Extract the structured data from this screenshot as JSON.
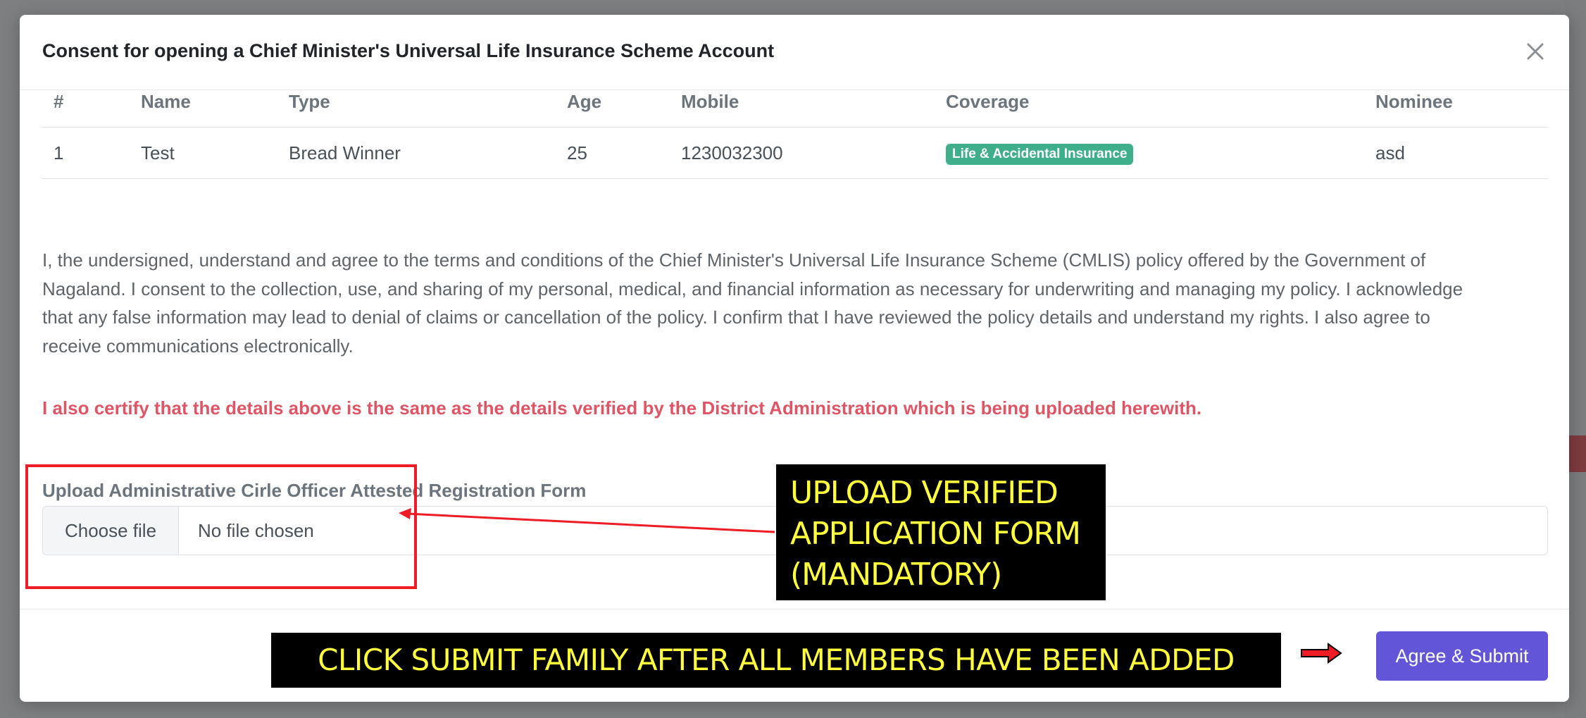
{
  "modal": {
    "title": "Consent for opening a Chief Minister's Universal Life Insurance Scheme Account",
    "close_icon": "close-icon"
  },
  "table": {
    "headers": [
      "#",
      "Name",
      "Type",
      "Age",
      "Mobile",
      "Coverage",
      "Nominee"
    ],
    "rows": [
      {
        "num": "1",
        "name": "Test",
        "type": "Bread Winner",
        "age": "25",
        "mobile": "1230032300",
        "coverage": "Life & Accidental Insurance",
        "nominee": "asd"
      }
    ]
  },
  "consent": {
    "lines": [
      "I, the undersigned, understand and agree to the terms and conditions of the Chief Minister's Universal Life Insurance Scheme (CMLIS) policy offered by the Government of",
      "Nagaland. I consent to the collection, use, and sharing of my personal, medical, and financial information as necessary for underwriting and managing my policy. I acknowledge",
      "that any false information may lead to denial of claims or cancellation of the policy. I confirm that I have reviewed the policy details and understand my rights. I also agree to",
      "receive communications electronically."
    ],
    "certify": "I also certify that the details above is the same as the details verified by the District Administration which is being uploaded herewith."
  },
  "upload": {
    "label": "Upload Administrative Cirle Officer Attested Registration Form",
    "choose_label": "Choose file",
    "status": "No file chosen"
  },
  "annotations": {
    "upload_lines": [
      "UPLOAD VERIFIED",
      "APPLICATION FORM",
      "(MANDATORY)"
    ],
    "submit_note": "CLICK SUBMIT FAMILY AFTER ALL MEMBERS HAVE BEEN ADDED"
  },
  "footer": {
    "agree_label": "Agree & Submit"
  },
  "colors": {
    "primary_button": "#6355d8",
    "badge": "#3fae8a",
    "certify_text": "#e05566",
    "annotation_text": "#ffff3c",
    "annotation_box": "#ee1d25"
  }
}
